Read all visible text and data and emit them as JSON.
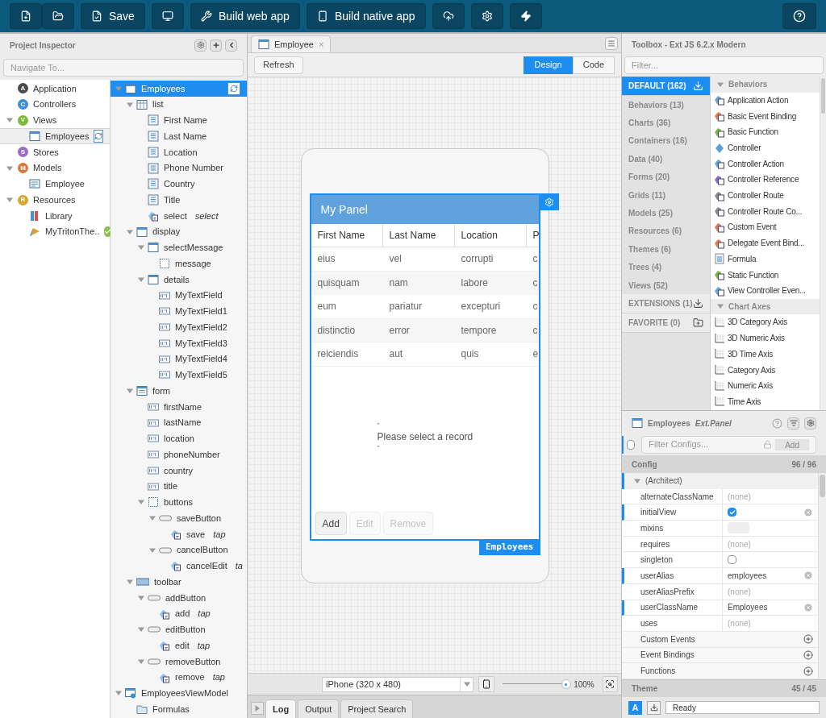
{
  "toolbar": {
    "save": "Save",
    "build_web": "Build web app",
    "build_native": "Build native app"
  },
  "inspector": {
    "title": "Project Inspector",
    "navigate_placeholder": "Navigate To...",
    "app_tree": [
      {
        "label": "Application",
        "badge": "A",
        "color": "#4a4a4a",
        "selected": false
      },
      {
        "label": "Controllers",
        "badge": "C",
        "color": "#3d8fd6",
        "selected": false
      },
      {
        "label": "Views",
        "badge": "V",
        "color": "#7cb83a",
        "selected": false,
        "expanded": true,
        "children": [
          {
            "label": "Employees",
            "kind": "view",
            "selected": true
          }
        ]
      },
      {
        "label": "Stores",
        "badge": "S",
        "color": "#9a6bc9",
        "selected": false
      },
      {
        "label": "Models",
        "badge": "M",
        "color": "#d9773f",
        "selected": false,
        "expanded": true,
        "children": [
          {
            "label": "Employee",
            "kind": "model",
            "selected": false
          }
        ]
      },
      {
        "label": "Resources",
        "badge": "R",
        "color": "#d4a62a",
        "selected": false,
        "expanded": true,
        "children": [
          {
            "label": "Library",
            "kind": "library",
            "selected": false
          },
          {
            "label": "MyTritonThe..",
            "kind": "theme",
            "selected": false,
            "valid": true
          }
        ]
      }
    ],
    "component_tree": [
      {
        "label": "Employees",
        "kind": "view",
        "selected": true,
        "expanded": true,
        "children": [
          {
            "label": "list",
            "kind": "grid",
            "selected": false,
            "expanded": true,
            "children": [
              {
                "label": "First Name",
                "kind": "column",
                "selected": false
              },
              {
                "label": "Last Name",
                "kind": "column",
                "selected": false
              },
              {
                "label": "Location",
                "kind": "column",
                "selected": false
              },
              {
                "label": "Phone Number",
                "kind": "column",
                "selected": false
              },
              {
                "label": "Country",
                "kind": "column",
                "selected": false
              },
              {
                "label": "Title",
                "kind": "column",
                "selected": false
              },
              {
                "label": "select",
                "event": "select",
                "kind": "event",
                "selected": false
              }
            ]
          },
          {
            "label": "display",
            "kind": "panel",
            "selected": false,
            "expanded": true,
            "children": [
              {
                "label": "selectMessage",
                "kind": "panel",
                "selected": false,
                "expanded": true,
                "children": [
                  {
                    "label": "message",
                    "kind": "container",
                    "selected": false
                  }
                ]
              },
              {
                "label": "details",
                "kind": "panel",
                "selected": false,
                "expanded": true,
                "children": [
                  {
                    "label": "MyTextField",
                    "kind": "textfield",
                    "selected": false
                  },
                  {
                    "label": "MyTextField1",
                    "kind": "textfield",
                    "selected": false
                  },
                  {
                    "label": "MyTextField2",
                    "kind": "textfield",
                    "selected": false
                  },
                  {
                    "label": "MyTextField3",
                    "kind": "textfield",
                    "selected": false
                  },
                  {
                    "label": "MyTextField4",
                    "kind": "textfield",
                    "selected": false
                  },
                  {
                    "label": "MyTextField5",
                    "kind": "textfield",
                    "selected": false
                  }
                ]
              }
            ]
          },
          {
            "label": "form",
            "kind": "form",
            "selected": false,
            "expanded": true,
            "children": [
              {
                "label": "firstName",
                "kind": "textfield",
                "selected": false
              },
              {
                "label": "lastName",
                "kind": "textfield",
                "selected": false
              },
              {
                "label": "location",
                "kind": "textfield",
                "selected": false
              },
              {
                "label": "phoneNumber",
                "kind": "textfield",
                "selected": false
              },
              {
                "label": "country",
                "kind": "textfield",
                "selected": false
              },
              {
                "label": "title",
                "kind": "textfield",
                "selected": false
              },
              {
                "label": "buttons",
                "kind": "container",
                "selected": false,
                "expanded": true,
                "children": [
                  {
                    "label": "saveButton",
                    "kind": "button",
                    "selected": false,
                    "expanded": true,
                    "children": [
                      {
                        "label": "save",
                        "event": "tap",
                        "kind": "event",
                        "selected": false
                      }
                    ]
                  },
                  {
                    "label": "cancelButton",
                    "kind": "button",
                    "selected": false,
                    "expanded": true,
                    "children": [
                      {
                        "label": "cancelEdit",
                        "event": "ta",
                        "kind": "event",
                        "selected": false
                      }
                    ]
                  }
                ]
              }
            ]
          },
          {
            "label": "toolbar",
            "kind": "toolbar",
            "selected": false,
            "expanded": true,
            "children": [
              {
                "label": "addButton",
                "kind": "button",
                "selected": false,
                "expanded": true,
                "children": [
                  {
                    "label": "add",
                    "event": "tap",
                    "kind": "event",
                    "selected": false
                  }
                ]
              },
              {
                "label": "editButton",
                "kind": "button",
                "selected": false,
                "expanded": true,
                "children": [
                  {
                    "label": "edit",
                    "event": "tap",
                    "kind": "event",
                    "selected": false
                  }
                ]
              },
              {
                "label": "removeButton",
                "kind": "button",
                "selected": false,
                "expanded": true,
                "children": [
                  {
                    "label": "remove",
                    "event": "tap",
                    "kind": "event",
                    "selected": false
                  }
                ]
              }
            ]
          }
        ]
      },
      {
        "label": "EmployeesViewModel",
        "kind": "viewmodel",
        "selected": false,
        "expanded": true,
        "children": [
          {
            "label": "Formulas",
            "kind": "folder",
            "selected": false
          }
        ]
      }
    ]
  },
  "editor": {
    "tabs": [
      {
        "label": "Employee",
        "close": "×",
        "selected": true
      }
    ],
    "refresh": "Refresh",
    "modes": [
      {
        "label": "Design",
        "selected": true
      },
      {
        "label": "Code",
        "selected": false
      }
    ],
    "panel": {
      "title": "My Panel",
      "columns": [
        "First Name",
        "Last Name",
        "Location",
        "P"
      ],
      "rows": [
        [
          "eius",
          "vel",
          "corrupti",
          "c"
        ],
        [
          "quisquam",
          "nam",
          "labore",
          "c"
        ],
        [
          "eum",
          "pariatur",
          "excepturi",
          "c"
        ],
        [
          "distinctio",
          "error",
          "tempore",
          "c"
        ],
        [
          "reiciendis",
          "aut",
          "quis",
          "e"
        ]
      ],
      "message": [
        "\"",
        "Please select a record",
        "\""
      ],
      "buttons": [
        {
          "label": "Add",
          "disabled": false
        },
        {
          "label": "Edit",
          "disabled": true
        },
        {
          "label": "Remove",
          "disabled": true
        }
      ],
      "badge": "Employees"
    },
    "device": "iPhone (320 x 480)",
    "zoom": {
      "level": 0.96,
      "reading": "100%"
    },
    "bottom_tabs": [
      {
        "label": "Log",
        "selected": true
      },
      {
        "label": "Output",
        "selected": false
      },
      {
        "label": "Project Search",
        "selected": false
      }
    ]
  },
  "toolbox": {
    "title": "Toolbox - Ext JS 6.2.x Modern",
    "filter_placeholder": "Filter...",
    "categories": [
      {
        "label": "DEFAULT (162)",
        "kind": "group",
        "selected": true
      },
      {
        "label": "Behaviors (13)",
        "kind": "category",
        "selected": false
      },
      {
        "label": "Charts (36)",
        "kind": "category",
        "selected": false
      },
      {
        "label": "Containers (16)",
        "kind": "category",
        "selected": false
      },
      {
        "label": "Data (40)",
        "kind": "category",
        "selected": false
      },
      {
        "label": "Forms (20)",
        "kind": "category",
        "selected": false
      },
      {
        "label": "Grids (11)",
        "kind": "category",
        "selected": false
      },
      {
        "label": "Models (25)",
        "kind": "category",
        "selected": false
      },
      {
        "label": "Resources (6)",
        "kind": "category",
        "selected": false
      },
      {
        "label": "Themes (6)",
        "kind": "category",
        "selected": false
      },
      {
        "label": "Trees (4)",
        "kind": "category",
        "selected": false
      },
      {
        "label": "Views (52)",
        "kind": "category",
        "selected": false
      },
      {
        "label": "EXTENSIONS (1)",
        "kind": "group",
        "selected": false
      },
      {
        "label": "FAVORITE (0)",
        "kind": "favorites",
        "selected": false
      }
    ],
    "sections": [
      {
        "title": "Behaviors",
        "expanded": true,
        "items": [
          {
            "label": "Application Action",
            "kind": "action",
            "color": "#6aa6dc"
          },
          {
            "label": "Basic Event Binding",
            "kind": "action",
            "color": "#e07b5a"
          },
          {
            "label": "Basic Function",
            "kind": "action",
            "color": "#79b84a"
          },
          {
            "label": "Controller",
            "kind": "controller",
            "color": "#5aa0e0"
          },
          {
            "label": "Controller Action",
            "kind": "action",
            "color": "#6aa6dc"
          },
          {
            "label": "Controller Reference",
            "kind": "action",
            "color": "#8a6cc8"
          },
          {
            "label": "Controller Route",
            "kind": "action",
            "color": "#8a8a8a"
          },
          {
            "label": "Controller Route Co...",
            "kind": "action",
            "color": "#8a8a8a"
          },
          {
            "label": "Custom Event",
            "kind": "action",
            "color": "#e07b5a"
          },
          {
            "label": "Delegate Event Bind...",
            "kind": "action",
            "color": "#e07b5a"
          },
          {
            "label": "Formula",
            "kind": "formula"
          },
          {
            "label": "Static Function",
            "kind": "action",
            "color": "#79b84a"
          },
          {
            "label": "View Controller Even...",
            "kind": "action",
            "color": "#6aa6dc"
          }
        ]
      },
      {
        "title": "Chart Axes",
        "expanded": true,
        "items": [
          {
            "label": "3D Category Axis",
            "kind": "axis"
          },
          {
            "label": "3D Numeric Axis",
            "kind": "axis"
          },
          {
            "label": "3D Time Axis",
            "kind": "axis"
          },
          {
            "label": "Category Axis",
            "kind": "axis"
          },
          {
            "label": "Numeric Axis",
            "kind": "axis"
          },
          {
            "label": "Time Axis",
            "kind": "axis"
          }
        ]
      }
    ]
  },
  "config": {
    "name": "Employees",
    "class": "Ext.Panel",
    "filter_placeholder": "Filter Configs...",
    "add": "Add",
    "show_all": false,
    "section": "Config",
    "count": "96 / 96",
    "group": "(Architect)",
    "group_expanded": true,
    "rows": [
      {
        "name": "alternateClassName",
        "kind": "empty",
        "value": "(none)",
        "modified": false
      },
      {
        "name": "initialView",
        "kind": "checkbox",
        "checked": true,
        "modified": true
      },
      {
        "name": "mixins",
        "kind": "object",
        "modified": false
      },
      {
        "name": "requires",
        "kind": "empty",
        "value": "(none)",
        "modified": false
      },
      {
        "name": "singleton",
        "kind": "checkbox",
        "checked": false,
        "modified": false
      },
      {
        "name": "userAlias",
        "kind": "text",
        "value": "employees",
        "modified": true
      },
      {
        "name": "userAliasPrefix",
        "kind": "empty",
        "value": "(none)",
        "modified": false
      },
      {
        "name": "userClassName",
        "kind": "text",
        "value": "Employees",
        "modified": true
      },
      {
        "name": "uses",
        "kind": "empty",
        "value": "(none)",
        "modified": false
      }
    ],
    "collections": [
      "Custom Events",
      "Event Bindings",
      "Functions"
    ],
    "theme": "Theme",
    "theme_count": "45 / 45",
    "mode_badge": "A",
    "status": "Ready"
  }
}
